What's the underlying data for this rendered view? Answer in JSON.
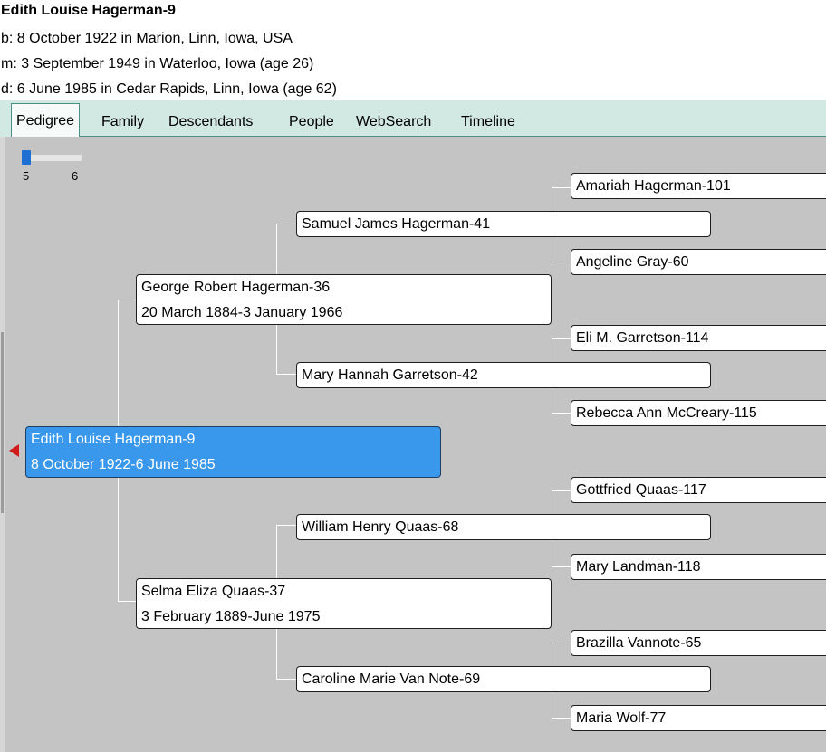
{
  "person": {
    "name": "Edith Louise Hagerman-9",
    "birth": "b: 8 October 1922 in Marion, Linn, Iowa, USA",
    "marriage": "m: 3 September 1949 in Waterloo, Iowa (age 26)",
    "death": "d: 6 June 1985 in Cedar Rapids, Linn, Iowa (age 62)"
  },
  "tabs": [
    "Pedigree",
    "Family",
    "Descendants",
    "People",
    "WebSearch",
    "Timeline"
  ],
  "active_tab": "Pedigree",
  "slider": {
    "min_label": "5",
    "max_label": "6",
    "value": 5
  },
  "colors": {
    "tabbar": "#d2e8e3",
    "canvas": "#c4c4c4",
    "selected": "#3a98ec",
    "marker": "#d21b1b"
  },
  "pedigree": {
    "root": {
      "name": "Edith Louise Hagerman-9",
      "dates": "8 October 1922-6 June 1985"
    },
    "father": {
      "name": "George Robert Hagerman-36",
      "dates": "20 March 1884-3 January 1966"
    },
    "mother": {
      "name": "Selma Eliza Quaas-37",
      "dates": "3 February 1889-June 1975"
    },
    "gen3": [
      "Samuel James Hagerman-41",
      "Mary Hannah Garretson-42",
      "William Henry Quaas-68",
      "Caroline Marie Van Note-69"
    ],
    "gen4": [
      "Amariah Hagerman-101",
      "Angeline Gray-60",
      "Eli M. Garretson-114",
      "Rebecca Ann McCreary-115",
      "Gottfried Quaas-117",
      "Mary Landman-118",
      "Brazilla Vannote-65",
      "Maria Wolf-77"
    ]
  }
}
